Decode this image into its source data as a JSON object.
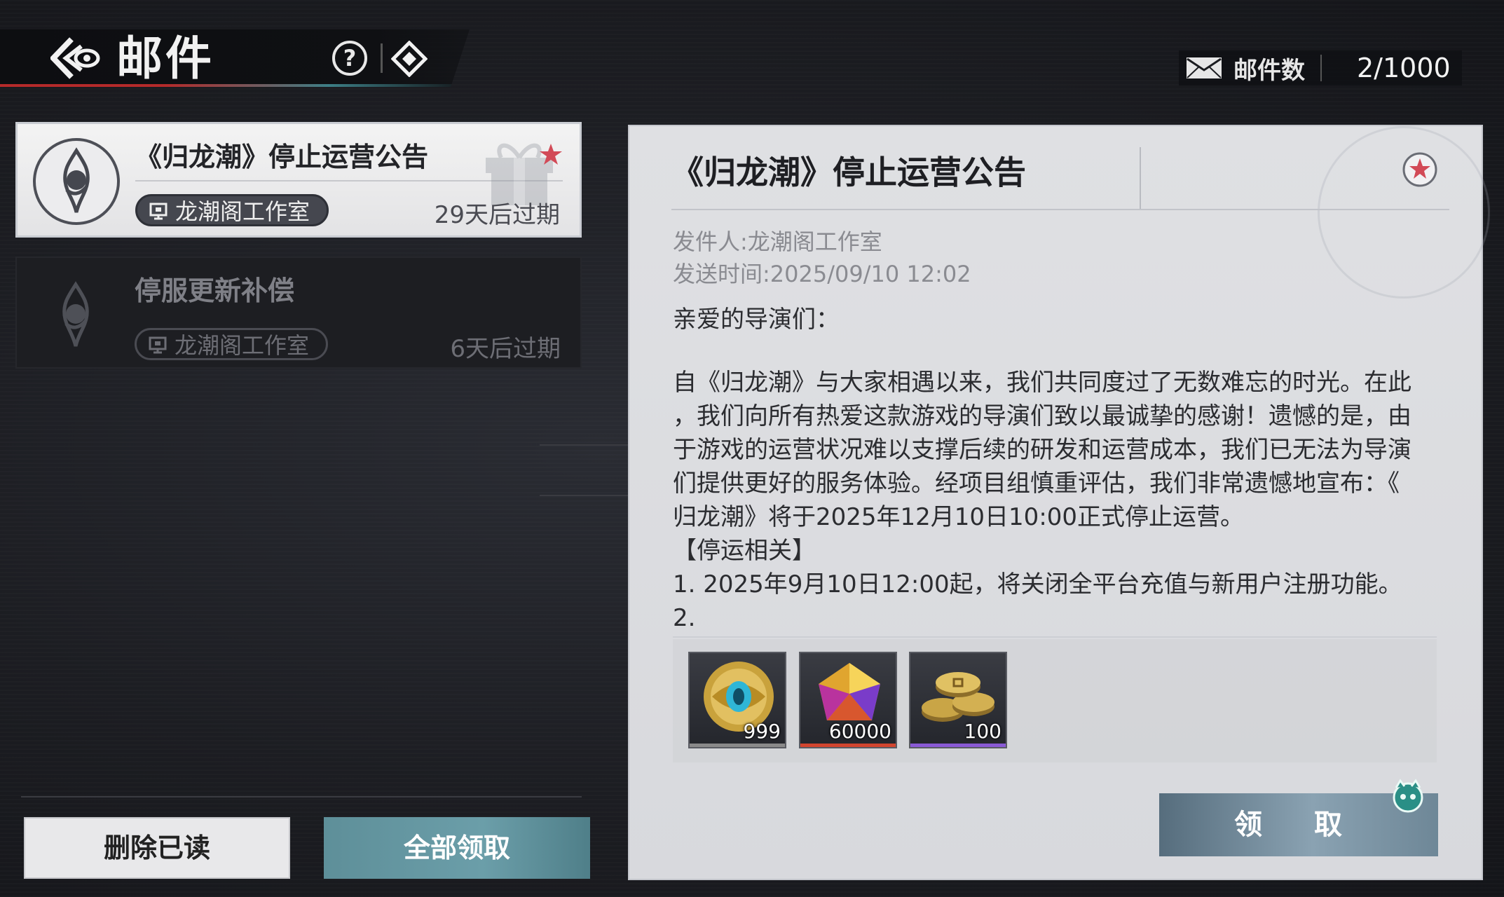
{
  "header": {
    "title": "邮件",
    "help_symbol": "?",
    "back_icon": "back-arrow-icon",
    "diamond_icon": "diamond-icon"
  },
  "mail_count": {
    "label": "邮件数",
    "value": "2/1000",
    "icon": "envelope-icon"
  },
  "mail_list": [
    {
      "title": "《归龙潮》停止运营公告",
      "sender": "龙潮阁工作室",
      "expiry": "29天后过期",
      "selected": true,
      "starred": true
    },
    {
      "title": "停服更新补偿",
      "sender": "龙潮阁工作室",
      "expiry": "6天后过期",
      "selected": false,
      "starred": false
    }
  ],
  "buttons": {
    "delete_read": "删除已读",
    "claim_all": "全部领取",
    "claim": "领 取"
  },
  "detail": {
    "title": "《归龙潮》停止运营公告",
    "sender_line": "发件人:龙潮阁工作室",
    "time_line": "发送时间:2025/09/10 12:02",
    "greeting": "亲爱的导演们：",
    "body": [
      "自《归龙潮》与大家相遇以来，我们共同度过了无数难忘的时光。在此",
      "，我们向所有热爱这款游戏的导演们致以最诚挚的感谢！遗憾的是，由",
      "于游戏的运营状况难以支撑后续的研发和运营成本，我们已无法为导演",
      "们提供更好的服务体验。经项目组慎重评估，我们非常遗憾地宣布：《",
      "归龙潮》将于2025年12月10日10:00正式停止运营。",
      "【停运相关】",
      "1. 2025年9月10日12:00起，将关闭全平台充值与新用户注册功能。",
      "2."
    ],
    "attachments": [
      {
        "icon": "gold-eye-coin-icon",
        "qty": "999",
        "rarity_color": "#8a8a8a"
      },
      {
        "icon": "prism-crystal-icon",
        "qty": "60000",
        "rarity_color": "#d2452f"
      },
      {
        "icon": "coin-stack-icon",
        "qty": "100",
        "rarity_color": "#8a5ad6"
      }
    ]
  },
  "colors": {
    "accent_red": "#b52a2a",
    "accent_teal": "#3d7f86",
    "claim_button": "#7b94a4",
    "star_red": "#d24a57"
  }
}
